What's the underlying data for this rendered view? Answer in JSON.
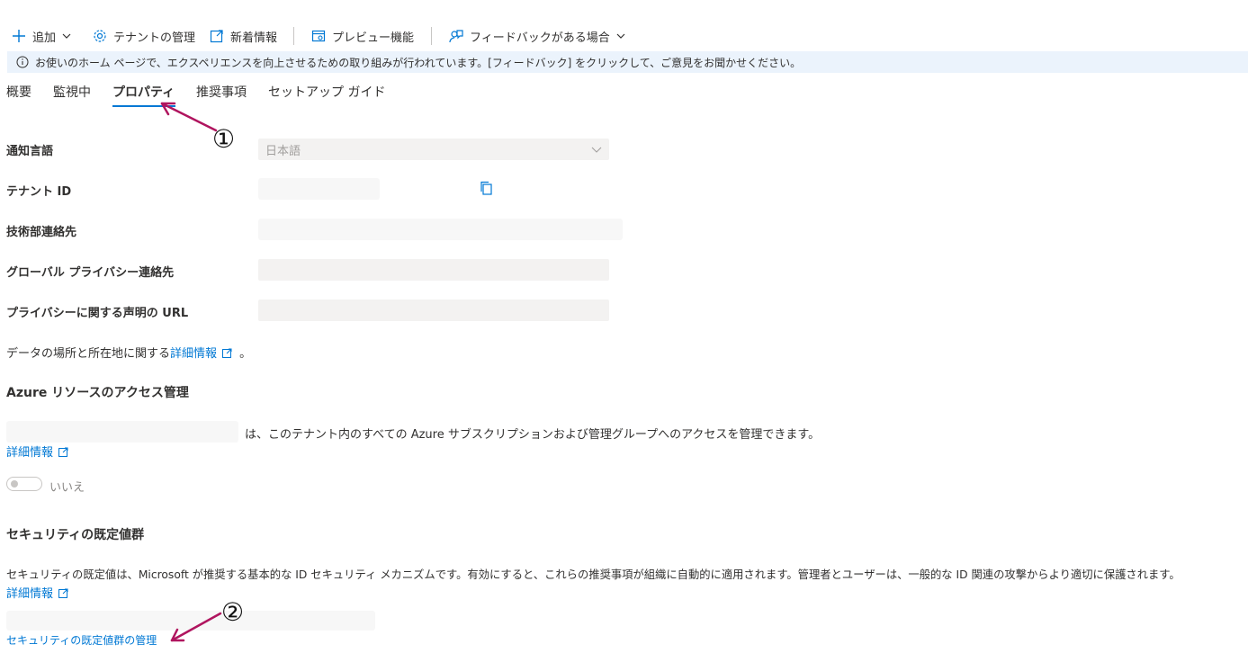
{
  "toolbar": {
    "add_label": "追加",
    "tenant_manage_label": "テナントの管理",
    "whats_new_label": "新着情報",
    "preview_label": "プレビュー機能",
    "feedback_label": "フィードバックがある場合"
  },
  "banner": {
    "text": "お使いのホーム ページで、エクスペリエンスを向上させるための取り組みが行われています。[フィードバック] をクリックして、ご意見をお聞かせください。"
  },
  "tabs": [
    {
      "label": "概要",
      "active": false
    },
    {
      "label": "監視中",
      "active": false
    },
    {
      "label": "プロパティ",
      "active": true
    },
    {
      "label": "推奨事項",
      "active": false
    },
    {
      "label": "セットアップ ガイド",
      "active": false
    }
  ],
  "form": {
    "notification_language_label": "通知言語",
    "notification_language_value": "日本語",
    "tenant_id_label": "テナント ID",
    "technical_contact_label": "技術部連絡先",
    "global_privacy_contact_label": "グローバル プライバシー連絡先",
    "privacy_statement_url_label": "プライバシーに関する声明の URL"
  },
  "data_location": {
    "prefix": "データの場所と所在地に関する",
    "link": "詳細情報",
    "suffix": "。"
  },
  "azure_access": {
    "heading": "Azure リソースのアクセス管理",
    "description": "は、このテナント内のすべての Azure サブスクリプションおよび管理グループへのアクセスを管理できます。",
    "learn_more": "詳細情報",
    "toggle_label": "いいえ",
    "toggle_on": false
  },
  "security_defaults": {
    "heading": "セキュリティの既定値群",
    "description": "セキュリティの既定値は、Microsoft が推奨する基本的な ID セキュリティ メカニズムです。有効にすると、これらの推奨事項が組織に自動的に適用されます。管理者とユーザーは、一般的な ID 関連の攻撃からより適切に保護されます。",
    "learn_more": "詳細情報",
    "manage_link": "セキュリティの既定値群の管理"
  },
  "annotations": {
    "marker_1": "①",
    "marker_2": "②",
    "color": "#b0155f"
  },
  "colors": {
    "accent": "#0078d4",
    "banner_bg": "#ebf3fc",
    "field_bg": "#f3f2f1"
  }
}
